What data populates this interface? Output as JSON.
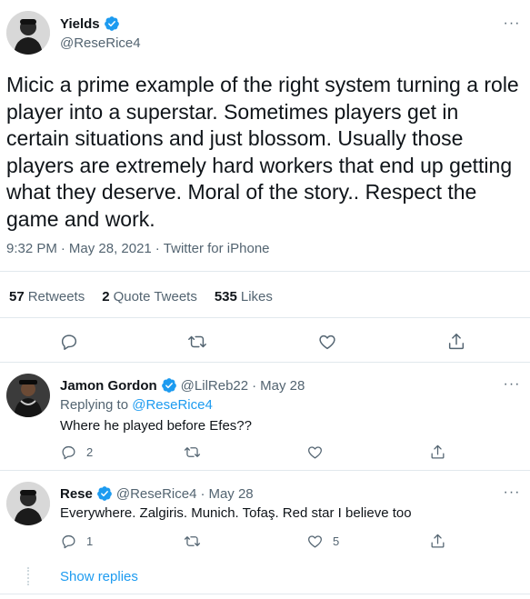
{
  "colors": {
    "accent": "#1d9bf0",
    "muted": "#536471",
    "text": "#0f1419",
    "divider": "#e1e8ed"
  },
  "main_tweet": {
    "author_name": "Yields",
    "author_handle": "@ReseRice4",
    "verified": true,
    "text": "Micic a prime example of the right system turning a role player into a superstar. Sometimes players get in certain situations and just blossom. Usually those players are extremely hard workers that end up getting what they deserve. Moral of the story.. Respect the game and work.",
    "time": "9:32 PM",
    "date": "May 28, 2021",
    "source": "Twitter for iPhone",
    "stats": {
      "retweets_count": "57",
      "retweets_label": "Retweets",
      "quotes_count": "2",
      "quotes_label": "Quote Tweets",
      "likes_count": "535",
      "likes_label": "Likes"
    },
    "actions": [
      "reply-icon",
      "retweet-icon",
      "like-icon",
      "share-icon"
    ]
  },
  "replies": [
    {
      "author_name": "Jamon Gordon",
      "verified": true,
      "author_handle": "@LilReb22",
      "date": "May 28",
      "replying_prefix": "Replying to",
      "replying_to": "@ReseRice4",
      "text": "Where he played before Efes??",
      "reply_count": "2",
      "retweet_count": "",
      "like_count": ""
    },
    {
      "author_name": "Rese",
      "verified": true,
      "author_handle": "@ReseRice4",
      "date": "May 28",
      "text": "Everywhere. Zalgiris. Munich. Tofaş. Red star I believe too",
      "reply_count": "1",
      "retweet_count": "",
      "like_count": "5"
    }
  ],
  "show_replies_label": "Show replies",
  "more_label": "···",
  "meta_separator": "·"
}
